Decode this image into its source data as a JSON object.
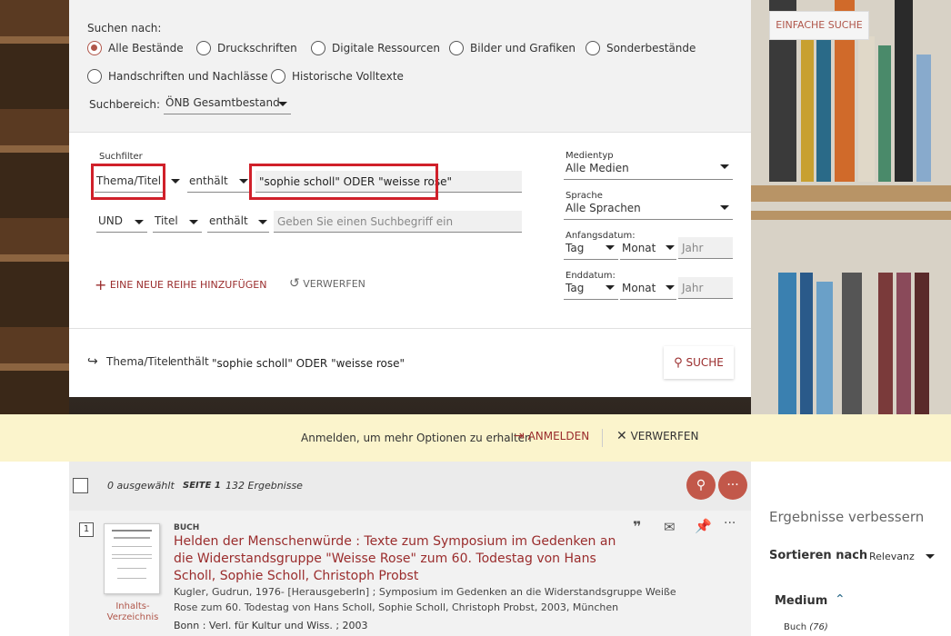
{
  "search": {
    "search_for_label": "Suchen nach:",
    "simple_search_button": "EINFACHE SUCHE",
    "scopes": [
      {
        "label": "Alle Bestände",
        "selected": true
      },
      {
        "label": "Druckschriften",
        "selected": false
      },
      {
        "label": "Digitale Ressourcen",
        "selected": false
      },
      {
        "label": "Bilder und Grafiken",
        "selected": false
      },
      {
        "label": "Sonderbestände",
        "selected": false
      },
      {
        "label": "Handschriften und Nachlässe",
        "selected": false
      },
      {
        "label": "Historische Volltexte",
        "selected": false
      }
    ],
    "search_area_label": "Suchbereich:",
    "search_area_value": "ÖNB Gesamtbestand"
  },
  "filters": {
    "label": "Suchfilter",
    "row1": {
      "field": "Thema/Titel",
      "operator": "enthält",
      "value": "\"sophie scholl\" ODER \"weisse rose\""
    },
    "row2": {
      "bool": "UND",
      "field": "Titel",
      "operator": "enthält",
      "placeholder": "Geben Sie einen Suchbegriff ein"
    },
    "add_row": "EINE NEUE REIHE HINZUFÜGEN",
    "discard": "VERWERFEN"
  },
  "facets": {
    "media_label": "Medientyp",
    "media_value": "Alle Medien",
    "lang_label": "Sprache",
    "lang_value": "Alle Sprachen",
    "start_label": "Anfangsdatum:",
    "end_label": "Enddatum:",
    "day": "Tag",
    "month": "Monat",
    "year_placeholder": "Jahr"
  },
  "summary": {
    "field": "Thema/Titel",
    "operator": "enthält",
    "value": "\"sophie scholl\" ODER \"weisse rose\"",
    "search_button": "SUCHE"
  },
  "login_bar": {
    "text": "Anmelden, um mehr Optionen zu erhalten",
    "login": "ANMELDEN",
    "discard": "VERWERFEN"
  },
  "results": {
    "selected": "0 ausgewählt",
    "page": "SEITE 1",
    "count": "132 Ergebnisse"
  },
  "item": {
    "number": "1",
    "type": "BUCH",
    "title": "Helden der Menschenwürde : Texte zum Symposium im Gedenken an die Widerstandsgruppe \"Weisse Rose\" zum 60. Todestag von Hans Scholl, Sophie Scholl, Christoph Probst",
    "authors": "Kugler, Gudrun, 1976- [HerausgeberIn] ; Symposium im Gedenken an die Widerstandsgruppe Weiße Rose zum 60. Todestag von Hans Scholl, Sophie Scholl, Christoph Probst, 2003, München",
    "publisher": "Bonn : Verl. für Kultur und Wiss. ; 2003",
    "toc_line1": "Inhalts-",
    "toc_line2": "Verzeichnis"
  },
  "sidebar": {
    "refine": "Ergebnisse verbessern",
    "sort_label": "Sortieren nach",
    "sort_value": "Relevanz",
    "medium": "Medium",
    "book": "Buch",
    "book_count": "(76)"
  },
  "colors": {
    "accent": "#b0564a",
    "highlight": "#d0202a",
    "bar": "#fbf4cc"
  }
}
